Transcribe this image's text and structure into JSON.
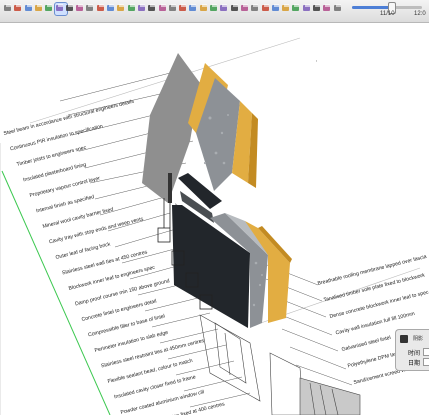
{
  "toolbar": {
    "buttons": [
      "select-tool",
      "paint-bucket-tool",
      "line-tool",
      "arc-tool",
      "push-pull-tool",
      "move-tool",
      "rotate-tool",
      "scale-tool",
      "offset-tool",
      "tape-measure-tool",
      "dimension-tool",
      "text-tool",
      "section-plane-tool",
      "orbit-tool",
      "pan-tool",
      "zoom-tool",
      "zoom-extents-tool",
      "iso-view",
      "top-view",
      "front-view",
      "right-view",
      "back-view",
      "left-view",
      "xray-style",
      "wireframe-style",
      "hidden-line-style",
      "shaded-style",
      "textured-style",
      "monochrome-style",
      "shadows-toggle",
      "fog-toggle",
      "warehouse",
      "components"
    ],
    "time_start": "11/10",
    "time_end": "12:0"
  },
  "annotations": {
    "left": [
      "Steel beam in accordance with structural engineers details",
      "Continuous PIR insulation to specification",
      "Timber joists to engineers spec",
      "Insulated plasterboard lining",
      "Proprietary vapour control layer",
      "Internal finish as specified",
      "Mineral wool cavity barrier fixed",
      "Cavity tray with stop ends and weep vents",
      "Outer leaf of facing brick",
      "Stainless steel wall ties at 450 centres",
      "Blockwork inner leaf to engineers spec",
      "Damp proof course min 150 above ground",
      "Concrete lintel to engineers detail",
      "Compressible filler to base of lintel",
      "Perimeter insulation to slab edge",
      "Stainless steel restraint ties at 450mm centres",
      "Flexible sealant bead, colour to match",
      "Insulated cavity closer fixed to frame",
      "Powder coated aluminium window cill",
      "Tanalised timber batten fixed at 400 centres"
    ],
    "right": [
      "Breathable roofing membrane lapped over fascia",
      "Tanalised timber sole plate fixed to blockwork",
      "Dense concrete blockwork inner leaf to spec",
      "Cavity wall insulation full fill 100mm",
      "Galvanised steel lintel",
      "Polyethylene DPM lapped with DPC",
      "Sand/cement screed with reinforcement mesh"
    ]
  },
  "shadow_panel": {
    "title": "阴影",
    "time_label": "时间",
    "date_label": "日期"
  },
  "colors": {
    "insulation_front": "#8d9196",
    "insulation_side": "#b7bbbf",
    "timber": "#e2ad42",
    "timber_dark": "#c38b22",
    "membrane": "#22262b",
    "shadow": "#8f8f8f",
    "guide_line": "#3cc850",
    "accent": "#4d7fd6"
  }
}
